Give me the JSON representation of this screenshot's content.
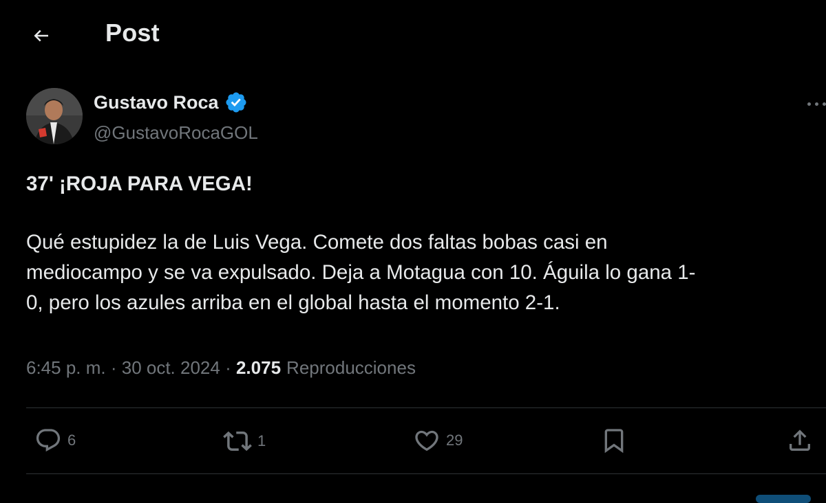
{
  "header": {
    "title": "Post",
    "back_icon": "arrow-left-icon"
  },
  "author": {
    "display_name": "Gustavo Roca",
    "handle": "@GustavoRocaGOL",
    "verified": true,
    "verified_color": "#1d9bf0"
  },
  "tweet": {
    "headline": "37' ¡ROJA PARA VEGA!",
    "body": "Qué estupidez la de Luis Vega. Comete dos faltas bobas casi en\nmediocampo y se va expulsado. Deja a Motagua con 10. Águila lo gana 1-\n0, pero los azules arriba en el global hasta el momento 2-1."
  },
  "meta": {
    "time": "6:45 p. m.",
    "separator": " · ",
    "date": "30 oct. 2024",
    "views_count": "2.075",
    "views_label": "Reproducciones"
  },
  "actions": {
    "replies": "6",
    "reposts": "1",
    "likes": "29"
  },
  "colors": {
    "background": "#000000",
    "text_primary": "#e7e9ea",
    "text_secondary": "#71767b",
    "divider": "#2f3336"
  }
}
